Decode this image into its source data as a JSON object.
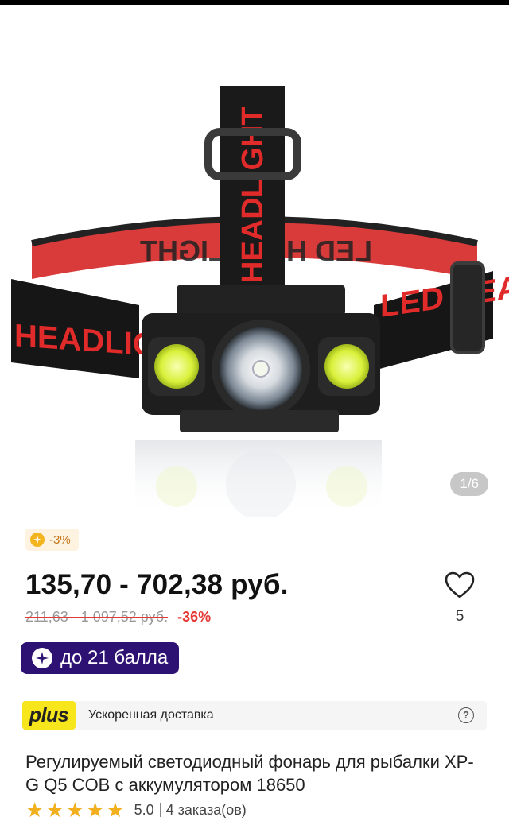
{
  "gallery": {
    "counter": "1/6",
    "band_text_left": "HEADLIGHT",
    "band_text_right": "LED HEADLIGHT",
    "strap_text": "HEADLIGHT",
    "mirror_text": "LED HEADLIGHT"
  },
  "promo": {
    "label": "-3%"
  },
  "price": {
    "current": "135,70 - 702,38 руб.",
    "old": "211,63 - 1 097,52 руб.",
    "discount": "-36%"
  },
  "favorite": {
    "count": "5"
  },
  "points": {
    "label": "до 21 балла"
  },
  "delivery": {
    "logo": "plus",
    "label": "Ускоренная доставка",
    "help": "?"
  },
  "product": {
    "title": "Регулируемый светодиодный фонарь для рыбалки XP-G Q5 COB с аккумулятором 18650"
  },
  "rating": {
    "score": "5.0",
    "orders": "4 заказа(ов)",
    "stars": 5
  },
  "colors": {
    "accent_red": "#e53935",
    "points_bg": "#2d1274",
    "plus_yellow": "#f7e61c",
    "star": "#f2b01e"
  }
}
